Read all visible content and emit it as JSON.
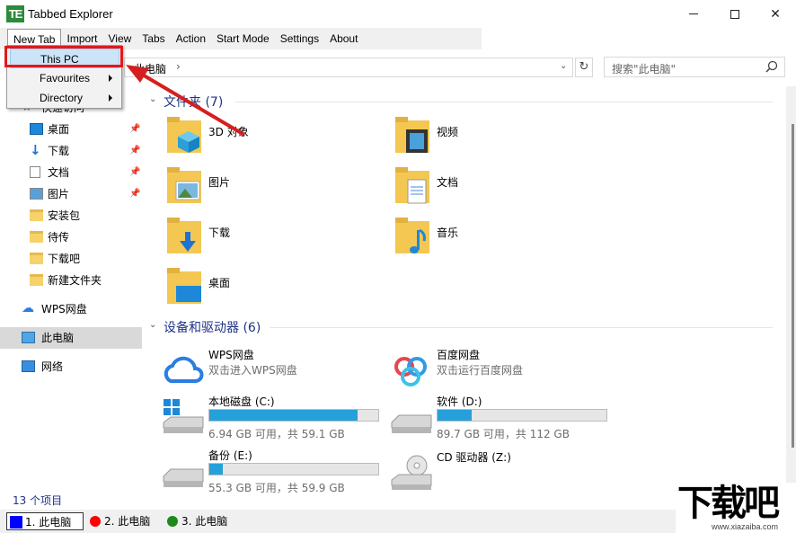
{
  "window": {
    "icon_text": "TE",
    "title": "Tabbed Explorer"
  },
  "menu": [
    "New Tab",
    "Import",
    "View",
    "Tabs",
    "Action",
    "Start Mode",
    "Settings",
    "About"
  ],
  "new_tab_menu": {
    "items": [
      "This PC",
      "Favourites",
      "Directory"
    ]
  },
  "address": {
    "path": "此电脑",
    "search_placeholder": "搜索\"此电脑\""
  },
  "sidebar": {
    "quick_access": "快速访问",
    "quick_items": [
      "桌面",
      "下载",
      "文档",
      "图片",
      "安装包",
      "待传",
      "下载吧",
      "新建文件夹"
    ],
    "wps": "WPS网盘",
    "this_pc": "此电脑",
    "network": "网络"
  },
  "folders": {
    "header": "文件夹 (7)",
    "items": [
      "3D 对象",
      "视频",
      "图片",
      "文档",
      "下载",
      "音乐",
      "桌面"
    ]
  },
  "devices": {
    "header": "设备和驱动器 (6)",
    "wps": {
      "name": "WPS网盘",
      "sub": "双击进入WPS网盘"
    },
    "baidu": {
      "name": "百度网盘",
      "sub": "双击运行百度网盘"
    },
    "drives": [
      {
        "name": "本地磁盘 (C:)",
        "space": "6.94 GB 可用，共 59.1 GB",
        "used": 0.88
      },
      {
        "name": "软件 (D:)",
        "space": "89.7 GB 可用，共 112 GB",
        "used": 0.2
      },
      {
        "name": "备份 (E:)",
        "space": "55.3 GB 可用，共 59.9 GB",
        "used": 0.08
      },
      {
        "name": "CD 驱动器 (Z:)"
      }
    ]
  },
  "status": {
    "count": "13 个项目"
  },
  "tabs": [
    {
      "label": "1. 此电脑",
      "color": "#0000ff"
    },
    {
      "label": "2. 此电脑",
      "color": "#ff0000"
    },
    {
      "label": "3. 此电脑",
      "color": "#1a8a1a"
    }
  ],
  "watermark": {
    "big": "下载吧",
    "small": "www.xiazaiba.com"
  }
}
